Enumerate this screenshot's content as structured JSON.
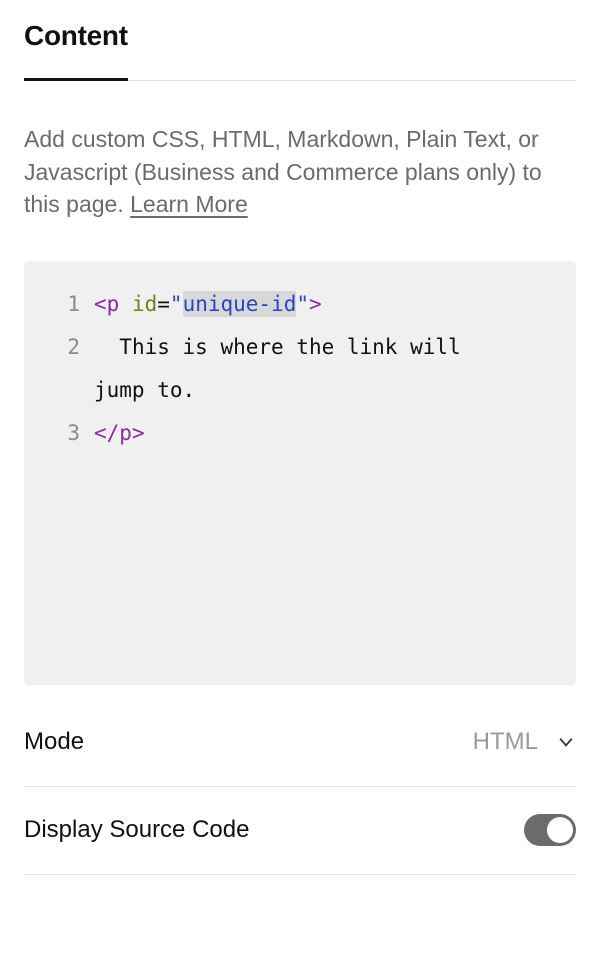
{
  "tabs": {
    "content_label": "Content"
  },
  "description": {
    "text_prefix": "Add custom CSS, HTML, Markdown, Plain Text, or Javascript (Business and Commerce plans only) to this page. ",
    "learn_more": "Learn More"
  },
  "editor": {
    "lines": [
      {
        "n": "1",
        "segments": [
          {
            "t": "<",
            "c": "tok-angle"
          },
          {
            "t": "p",
            "c": "tok-tag"
          },
          {
            "t": " ",
            "c": ""
          },
          {
            "t": "id",
            "c": "tok-attr"
          },
          {
            "t": "=",
            "c": "tok-punct-eq"
          },
          {
            "t": "\"",
            "c": "tok-str"
          },
          {
            "t": "unique-id",
            "c": "tok-str hl"
          },
          {
            "t": "\"",
            "c": "tok-str"
          },
          {
            "t": ">",
            "c": "tok-angle"
          }
        ]
      },
      {
        "n": "2",
        "segments": [
          {
            "t": "  This is where the link will ",
            "c": ""
          }
        ]
      },
      {
        "n": "",
        "cont": true,
        "segments": [
          {
            "t": "jump to.",
            "c": ""
          }
        ]
      },
      {
        "n": "3",
        "segments": [
          {
            "t": "<",
            "c": "tok-angle"
          },
          {
            "t": "/p",
            "c": "tok-tag"
          },
          {
            "t": ">",
            "c": "tok-angle"
          }
        ]
      }
    ]
  },
  "controls": {
    "mode_label": "Mode",
    "mode_value": "HTML",
    "display_source_label": "Display Source Code",
    "display_source_on": true
  }
}
